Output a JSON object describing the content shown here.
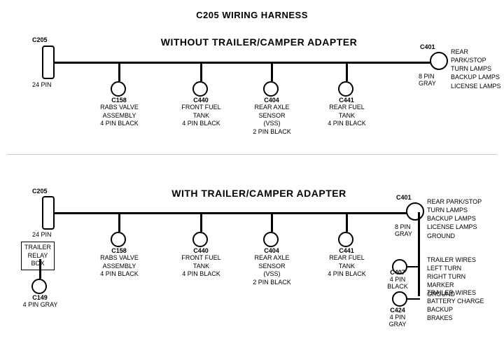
{
  "title": "C205 WIRING HARNESS",
  "section1": {
    "label": "WITHOUT TRAILER/CAMPER ADAPTER",
    "left_connector": {
      "id": "C205",
      "pin": "24 PIN"
    },
    "right_connector": {
      "id": "C401",
      "pin": "8 PIN",
      "color": "GRAY",
      "description": "REAR PARK/STOP\nTURN LAMPS\nBACKUP LAMPS\nLICENSE LAMPS"
    },
    "connectors": [
      {
        "id": "C158",
        "label": "RABS VALVE\nASSEMBLY\n4 PIN BLACK"
      },
      {
        "id": "C440",
        "label": "FRONT FUEL\nTANK\n4 PIN BLACK"
      },
      {
        "id": "C404",
        "label": "REAR AXLE\nSENSOR\n(VSS)\n2 PIN BLACK"
      },
      {
        "id": "C441",
        "label": "REAR FUEL\nTANK\n4 PIN BLACK"
      }
    ]
  },
  "section2": {
    "label": "WITH TRAILER/CAMPER ADAPTER",
    "left_connector": {
      "id": "C205",
      "pin": "24 PIN"
    },
    "right_connector": {
      "id": "C401",
      "pin": "8 PIN",
      "color": "GRAY",
      "description": "REAR PARK/STOP\nTURN LAMPS\nBACKUP LAMPS\nLICENSE LAMPS\nGROUND"
    },
    "extra_left": {
      "box": "TRAILER\nRELAY\nBOX",
      "connector_id": "C149",
      "connector_pin": "4 PIN GRAY"
    },
    "connectors": [
      {
        "id": "C158",
        "label": "RABS VALVE\nASSEMBLY\n4 PIN BLACK"
      },
      {
        "id": "C440",
        "label": "FRONT FUEL\nTANK\n4 PIN BLACK"
      },
      {
        "id": "C404",
        "label": "REAR AXLE\nSENSOR\n(VSS)\n2 PIN BLACK"
      },
      {
        "id": "C441",
        "label": "REAR FUEL\nTANK\n4 PIN BLACK"
      }
    ],
    "right_connectors": [
      {
        "id": "C407",
        "pin": "4 PIN",
        "color": "BLACK",
        "description": "TRAILER WIRES\nLEFT TURN\nRIGHT TURN\nMARKER\nGROUND"
      },
      {
        "id": "C424",
        "pin": "4 PIN",
        "color": "GRAY",
        "description": "TRAILER WIRES\nBATTERY CHARGE\nBACKUP\nBRAKES"
      }
    ]
  }
}
